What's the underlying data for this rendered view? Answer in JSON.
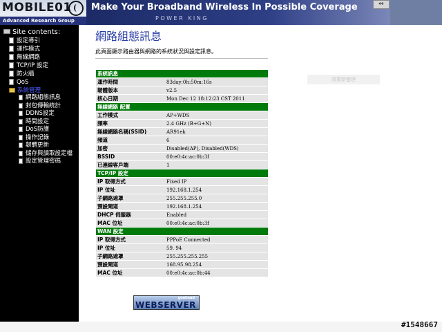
{
  "header": {
    "logo_text": "MOBILE01",
    "logo_sub": "Advanced Research Group",
    "tagline": "Make Your Broadband Wireless In Possible Coverage",
    "subtag": "POWER KING",
    "corner_button": "⇔"
  },
  "sidebar": {
    "title": "Site contents:",
    "items": [
      {
        "label": "設定導引",
        "icon": "doc-icon"
      },
      {
        "label": "運作模式",
        "icon": "doc-icon"
      },
      {
        "label": "無線網路",
        "icon": "doc-icon"
      },
      {
        "label": "TCP/IP 設定",
        "icon": "doc-icon"
      },
      {
        "label": "防火牆",
        "icon": "doc-icon"
      },
      {
        "label": "QoS",
        "icon": "doc-icon"
      },
      {
        "label": "系統管理",
        "icon": "folder-icon",
        "selected": true
      }
    ],
    "subitems": [
      {
        "label": "網路組態訊息"
      },
      {
        "label": "封包傳輸統計"
      },
      {
        "label": "DDNS設定"
      },
      {
        "label": "時間設定"
      },
      {
        "label": "DoS防護"
      },
      {
        "label": "操作記錄"
      },
      {
        "label": "韌體更新"
      },
      {
        "label": "儲存與讀取設定檔"
      },
      {
        "label": "設定管理密碼"
      }
    ]
  },
  "main": {
    "title": "網路組態訊息",
    "description": "此頁面顯示路由器與網路的系統狀況與設定訊息。",
    "faded_box": "請重新整理"
  },
  "sections": [
    {
      "title": "系統訊息",
      "rows": [
        {
          "label": "運作時間",
          "value": "83day:0h:50m:16s"
        },
        {
          "label": "韌體版本",
          "value": "v2.5"
        },
        {
          "label": "核心日期",
          "value": "Mon Dec 12 18:12:23 CST 2011"
        }
      ]
    },
    {
      "title": "無線網路 配置",
      "rows": [
        {
          "label": "工作模式",
          "value": "AP+WDS"
        },
        {
          "label": "頻率",
          "value": "2.4 GHz (B+G+N)"
        },
        {
          "label": "無線網路名稱(SSID)",
          "value": "AR91ek"
        },
        {
          "label": "頻道",
          "value": "6"
        },
        {
          "label": "加密",
          "value": "Disabled(AP), Disabled(WDS)"
        },
        {
          "label": "BSSID",
          "value": "00:e0:4c:ac:0b:3f"
        },
        {
          "label": "已連線客戶端",
          "value": "1"
        }
      ]
    },
    {
      "title": "TCP/IP 設定",
      "rows": [
        {
          "label": "IP 取得方式",
          "value": "Fixed IP"
        },
        {
          "label": "IP 位址",
          "value": "192.168.1.254"
        },
        {
          "label": "子網路遮罩",
          "value": "255.255.255.0"
        },
        {
          "label": "預設閘道",
          "value": "192.168.1.254"
        },
        {
          "label": "DHCP 伺服器",
          "value": "Enabled"
        },
        {
          "label": "MAC 位址",
          "value": "00:e0:4c:ac:0b:3f"
        }
      ]
    },
    {
      "title": "WAN 設定",
      "rows": [
        {
          "label": "IP 取得方式",
          "value": "PPPoE Connected"
        },
        {
          "label": "IP 位址",
          "value": "59.            94"
        },
        {
          "label": "子網路遮罩",
          "value": "255.255.255.255"
        },
        {
          "label": "預設閘道",
          "value": "168.95.98.254"
        },
        {
          "label": "MAC 位址",
          "value": "00:e0:4c:ac:0b:44"
        }
      ]
    }
  ],
  "footer": {
    "badge_small": "goahead",
    "badge_big": "WEBSERVER",
    "watermark": "#1548667"
  }
}
